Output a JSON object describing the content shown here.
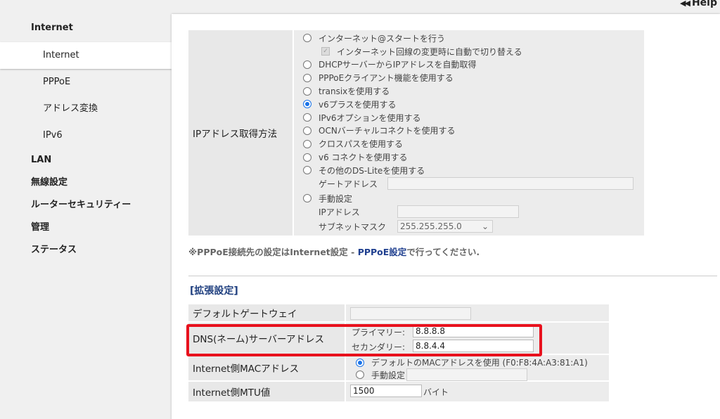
{
  "help": {
    "label": "Help",
    "icon": "◀◀"
  },
  "sidebar": {
    "internet_header": "Internet",
    "internet_items": [
      "Internet",
      "PPPoE",
      "アドレス変換",
      "IPv6"
    ],
    "lan": "LAN",
    "wireless": "無線設定",
    "router_security": "ルーターセキュリティー",
    "admin": "管理",
    "status": "ステータス"
  },
  "ip_method": {
    "label": "IPアドレス取得方法",
    "options": [
      "インターネット@スタートを行う",
      "インターネット回線の変更時に自動で切り替える",
      "DHCPサーバーからIPアドレスを自動取得",
      "PPPoEクライアント機能を使用する",
      "transixを使用する",
      "v6プラスを使用する",
      "IPv6オプションを使用する",
      "OCNバーチャルコネクトを使用する",
      "クロスパスを使用する",
      "v6 コネクトを使用する",
      "その他のDS-Liteを使用する"
    ],
    "selected": "v6プラスを使用する",
    "gateway_label": "ゲートアドレス",
    "manual_label": "手動設定",
    "ip_label": "IPアドレス",
    "subnet_label": "サブネットマスク",
    "subnet_value": "255.255.255.0"
  },
  "note": {
    "prefix": "※PPPoE接続先の設定はInternet設定 - ",
    "link": "PPPoE設定",
    "suffix": "で行ってください."
  },
  "extended": {
    "title": "[拡張設定]",
    "default_gateway_label": "デフォルトゲートウェイ",
    "dns_label": "DNS(ネーム)サーバーアドレス",
    "primary_label": "プライマリー:",
    "primary_value": "8.8.8.8",
    "secondary_label": "セカンダリー:",
    "secondary_value": "8.8.4.4",
    "mac_label": "Internet側MACアドレス",
    "mac_default": "デフォルトのMACアドレスを使用 (F0:F8:4A:A3:81:A1)",
    "mac_manual": "手動設定",
    "mtu_label": "Internet側MTU値",
    "mtu_value": "1500",
    "mtu_unit": "バイト"
  },
  "colors": {
    "accent": "#1a73e8",
    "highlight": "#e8111d",
    "link": "#1f3f8f"
  }
}
